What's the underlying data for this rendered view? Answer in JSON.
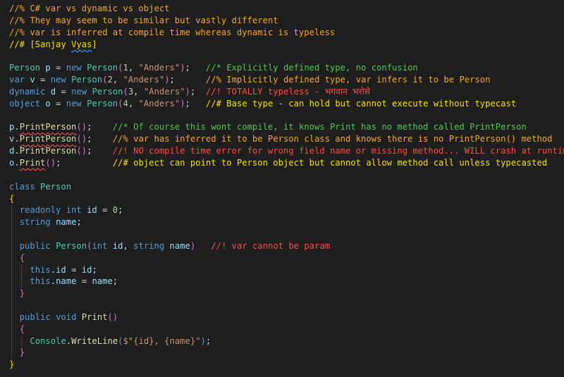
{
  "header_comments": [
    "//% C# var vs dynamic vs object",
    "//% They may seem to be similar but vastly different",
    "//% var is inferred at compile time whereas dynamic is typeless",
    "//# [Sanjay ",
    "Vyas",
    "]"
  ],
  "decls": [
    {
      "type": "Person",
      "name": "p",
      "eq": " = ",
      "kw": "new",
      "ctor": "Person",
      "num": "1",
      "str": "\"Anders\"",
      "pad": "   ",
      "comment": "//* Explicitly defined type, no confusion",
      "comment_color": "green"
    },
    {
      "type": "var",
      "name": "v",
      "eq": " = ",
      "kw": "new",
      "ctor": "Person",
      "num": "2",
      "str": "\"Anders\"",
      "pad": "      ",
      "comment": "//% Implicitly defined type, var infers it to be Person",
      "comment_color": "orange"
    },
    {
      "type": "dynamic",
      "name": "d",
      "eq": " = ",
      "kw": "new",
      "ctor": "Person",
      "num": "3",
      "str": "\"Anders\"",
      "pad": "  ",
      "comment": "//! TOTALLY typeless - भगवान भरोसे",
      "comment_color": "red"
    },
    {
      "type": "object",
      "name": "o",
      "eq": " = ",
      "kw": "new",
      "ctor": "Person",
      "num": "4",
      "str": "\"Anders\"",
      "pad": "   ",
      "comment": "//# Base type - can hold but cannot execute without typecast",
      "comment_color": "yellow"
    }
  ],
  "calls": [
    {
      "obj": "p",
      "method": "PrintPerson",
      "pad": "    ",
      "comment": "//* Of course this wont compile, it knows Print has no method called PrintPerson",
      "comment_color": "green"
    },
    {
      "obj": "v",
      "method": "PrintPerson",
      "pad": "    ",
      "comment": "//% var has inferred it to be Person class and knows there is no PrintPerson() method",
      "comment_color": "orange"
    },
    {
      "obj": "d",
      "method": "PrintPerson",
      "pad": "    ",
      "comment": "//! NO compile time error for wrong field name or missing method... WILL crash at runtime",
      "comment_color": "red"
    },
    {
      "obj": "o",
      "method": "Print",
      "pad": "          ",
      "comment": "//# object can point to Person object but cannot allow method call unless typecasted",
      "comment_color": "yellow"
    }
  ],
  "class_block": {
    "class_kw": "class",
    "class_name": "Person",
    "open": "{",
    "close": "}",
    "field1": {
      "mod": "readonly",
      "type": "int",
      "name": "id",
      "eq": " = ",
      "val": "0",
      "semi": ";"
    },
    "field2": {
      "type": "string",
      "name": "name",
      "semi": ";"
    },
    "ctor": {
      "mod": "public",
      "name": "Person",
      "p1type": "int",
      "p1": "id",
      "p2type": "string",
      "p2": "name",
      "comment": "//! var cannot be param"
    },
    "ctor_body": [
      {
        "this": "this",
        "field": "id",
        "rhs": "id"
      },
      {
        "this": "this",
        "field": "name",
        "rhs": "name"
      }
    ],
    "method": {
      "mod": "public",
      "ret": "void",
      "name": "Print"
    },
    "method_body": {
      "cls": "Console",
      "fn": "WriteLine",
      "interp": "$\"{id}, {name}\""
    }
  }
}
